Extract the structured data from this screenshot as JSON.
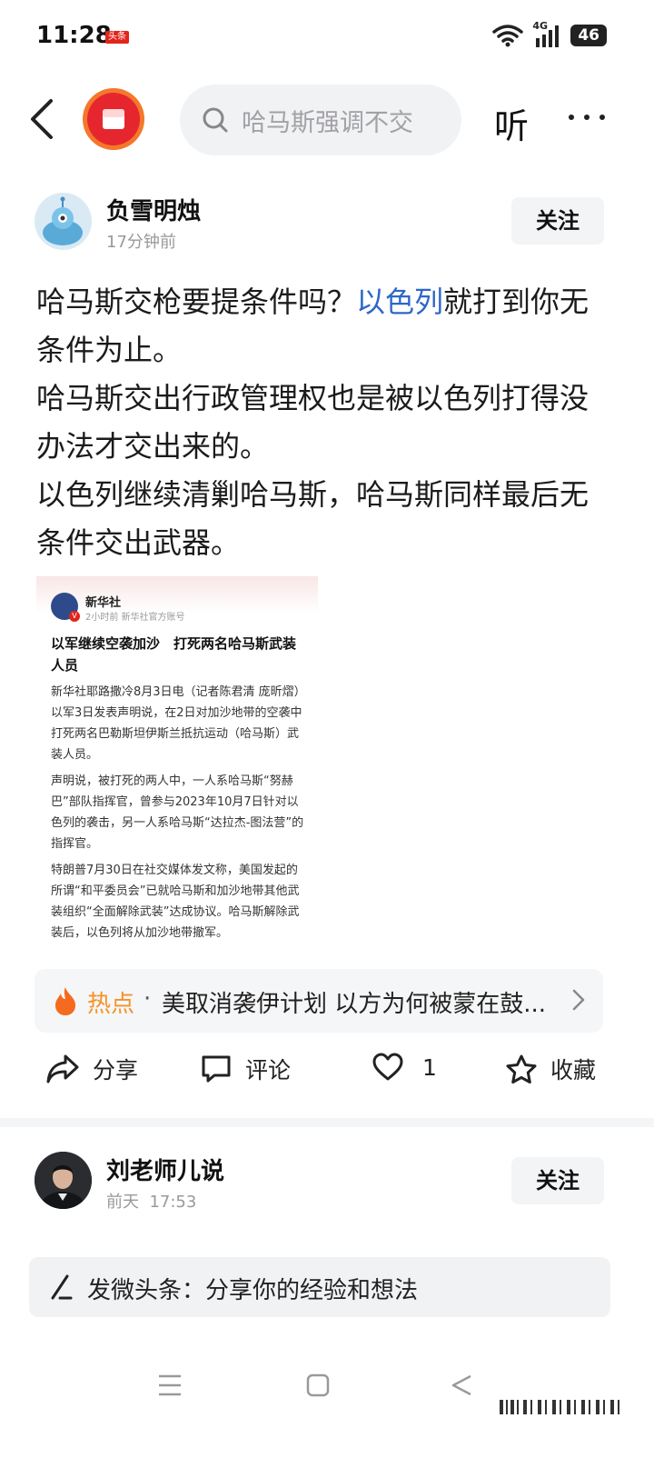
{
  "status_bar": {
    "time": "11:28",
    "app_badge": "头条",
    "network": "4G",
    "battery": "46"
  },
  "nav": {
    "search_placeholder": "哈马斯强调不交",
    "listen_label": "听"
  },
  "post": {
    "author": "负雪明烛",
    "time": "17分钟前",
    "follow_label": "关注",
    "paragraphs": [
      {
        "before": "哈马斯交枪要提条件吗？",
        "link": "以色列",
        "after": "就打到你无条件为止。"
      },
      {
        "text": "哈马斯交出行政管理权也是被以色列打得没办法才交出来的。"
      },
      {
        "text": "以色列继续清剿哈马斯，哈马斯同样最后无条件交出武器。"
      }
    ],
    "embed": {
      "source": "新华社",
      "source_sub": "2小时前 新华社官方账号",
      "title": "以军继续空袭加沙　打死两名哈马斯武装人员",
      "body": [
        "新华社耶路撒冷8月3日电（记者陈君清 庞昕熠）以军3日发表声明说，在2日对加沙地带的空袭中打死两名巴勒斯坦伊斯兰抵抗运动（哈马斯）武装人员。",
        "声明说，被打死的两人中，一人系哈马斯“努赫巴”部队指挥官，曾参与2023年10月7日针对以色列的袭击，另一人系哈马斯“达拉杰-图法营”的指挥官。",
        "特朗普7月30日在社交媒体发文称，美国发起的所谓“和平委员会”已就哈马斯和加沙地带其他武装组织“全面解除武装”达成协议。哈马斯解除武装后，以色列将从加沙地带撤军。"
      ]
    },
    "hot": {
      "label": "热点",
      "separator": "·",
      "headline": "美取消袭伊计划 以方为何被蒙在鼓..."
    },
    "actions": {
      "share": "分享",
      "comment": "评论",
      "like_count": "1",
      "favorite": "收藏"
    }
  },
  "next_post": {
    "author": "刘老师儿说",
    "day": "前天",
    "time": "17:53",
    "follow_label": "关注"
  },
  "compose": {
    "placeholder": "发微头条：分享你的经验和想法"
  },
  "colors": {
    "link": "#2d67c8",
    "hot_label": "#f5922a",
    "fire": "#f56a1f",
    "badge": "#e1251b"
  }
}
